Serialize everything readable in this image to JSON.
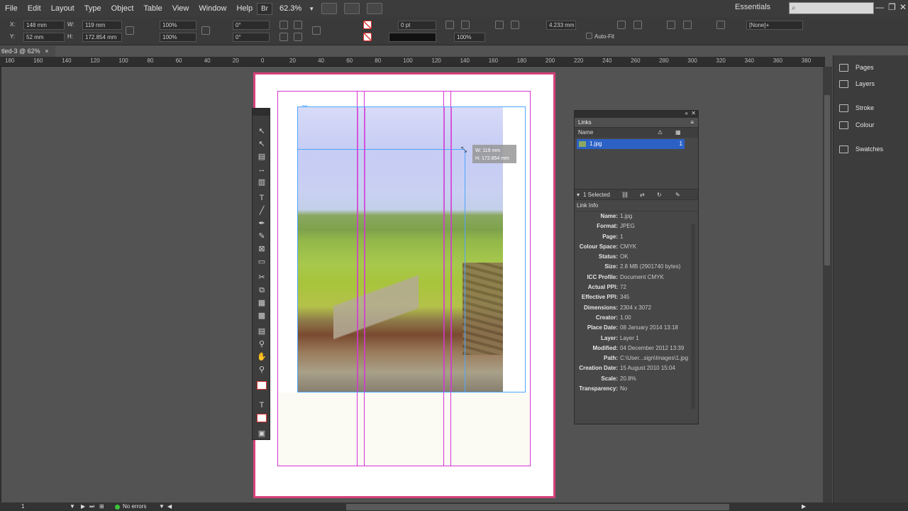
{
  "menu": [
    "File",
    "Edit",
    "Layout",
    "Type",
    "Object",
    "Table",
    "View",
    "Window",
    "Help"
  ],
  "menubar": {
    "bridge_label": "Br",
    "zoom": "62.3%",
    "workspace": "Essentials",
    "search_placeholder": "",
    "minimize": "—",
    "restore": "❐",
    "close": "✕"
  },
  "control": {
    "x_label": "X:",
    "x_value": "148 mm",
    "y_label": "Y:",
    "y_value": "52 mm",
    "w_label": "W:",
    "w_value": "119 mm",
    "h_label": "H:",
    "h_value": "172.854 mm",
    "scale_x": "100%",
    "scale_y": "100%",
    "rotate": "0°",
    "shear": "0°",
    "stroke_weight": "0 pt",
    "opacity": "100%",
    "dimension": "4.233 mm",
    "autofit_label": "Auto-Fit",
    "object_style": "[None]+"
  },
  "document_tab": {
    "title": "tled-3 @ 62%",
    "close": "×"
  },
  "ruler_ticks": [
    "180",
    "160",
    "140",
    "120",
    "100",
    "80",
    "60",
    "40",
    "20",
    "0",
    "20",
    "40",
    "60",
    "80",
    "100",
    "120",
    "140",
    "160",
    "180",
    "200",
    "220",
    "240",
    "260",
    "280",
    "300",
    "320",
    "340",
    "360",
    "380"
  ],
  "tooltip": {
    "width": "W: 119 mm",
    "height": "H: 172.854 mm"
  },
  "links_panel": {
    "tab": "Links",
    "column_name": "Name",
    "file": "1.jpg",
    "page_num": "1",
    "selected": "1 Selected",
    "link_info_label": "Link Info",
    "info": [
      {
        "label": "Name:",
        "value": "1.jpg"
      },
      {
        "label": "Format:",
        "value": "JPEG"
      },
      {
        "label": "Page:",
        "value": "1"
      },
      {
        "label": "Colour Space:",
        "value": "CMYK"
      },
      {
        "label": "Status:",
        "value": "OK"
      },
      {
        "label": "Size:",
        "value": "2.8 MB (2901740 bytes)"
      },
      {
        "label": "ICC Profile:",
        "value": "Document CMYK"
      },
      {
        "label": "Actual PPI:",
        "value": "72"
      },
      {
        "label": "Effective PPI:",
        "value": "345"
      },
      {
        "label": "Dimensions:",
        "value": "2304 x 3072"
      },
      {
        "label": "Creator:",
        "value": "1.00"
      },
      {
        "label": "Place Date:",
        "value": "08 January 2014 13:18"
      },
      {
        "label": "Layer:",
        "value": "Layer 1"
      },
      {
        "label": "Modified:",
        "value": "04 December 2012 13:39"
      },
      {
        "label": "Path:",
        "value": "C:\\User...sign\\Images\\1.jpg"
      },
      {
        "label": "Creation Date:",
        "value": "15 August 2010 15:04"
      },
      {
        "label": "Scale:",
        "value": "20.8%"
      },
      {
        "label": "Transparency:",
        "value": "No"
      }
    ]
  },
  "right_dock": [
    {
      "label": "Pages",
      "icon": "pages-icon"
    },
    {
      "label": "Layers",
      "icon": "layers-icon"
    },
    {
      "label": "Stroke",
      "icon": "stroke-icon"
    },
    {
      "label": "Colour",
      "icon": "colour-icon"
    },
    {
      "label": "Swatches",
      "icon": "swatches-icon"
    }
  ],
  "statusbar": {
    "page": "1",
    "errors": "No errors"
  },
  "colors": {
    "guide": "#d534d5",
    "frame": "#4da6ff",
    "selection": "#2c62c6",
    "page_border": "#d6407a"
  }
}
